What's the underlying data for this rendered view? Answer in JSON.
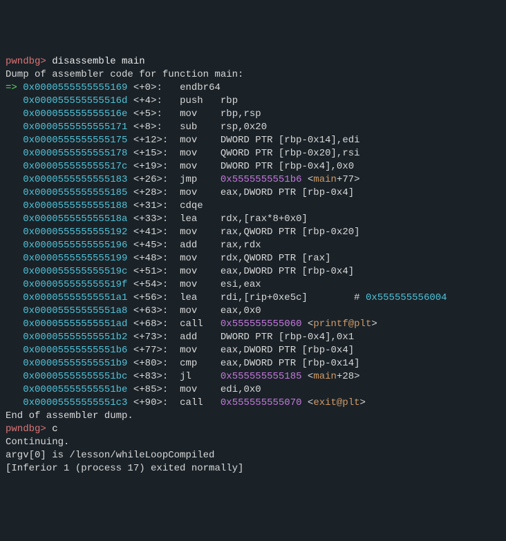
{
  "prompt": "pwndbg>",
  "cmd1": "disassemble main",
  "dump_header": "Dump of assembler code for function main:",
  "arrow": "=>",
  "lines": [
    {
      "addr": "0x0000555555555169",
      "off": "<+0>:",
      "instr": "endbr64"
    },
    {
      "addr": "0x000055555555516d",
      "off": "<+4>:",
      "instr": "push   rbp"
    },
    {
      "addr": "0x000055555555516e",
      "off": "<+5>:",
      "instr": "mov    rbp,rsp"
    },
    {
      "addr": "0x0000555555555171",
      "off": "<+8>:",
      "instr": "sub    rsp,0x20"
    },
    {
      "addr": "0x0000555555555175",
      "off": "<+12>:",
      "instr": "mov    DWORD PTR [rbp-0x14],edi"
    },
    {
      "addr": "0x0000555555555178",
      "off": "<+15>:",
      "instr": "mov    QWORD PTR [rbp-0x20],rsi"
    },
    {
      "addr": "0x000055555555517c",
      "off": "<+19>:",
      "instr": "mov    DWORD PTR [rbp-0x4],0x0"
    },
    {
      "addr": "0x0000555555555183",
      "off": "<+26>:",
      "instr": "jmp    ",
      "ref_addr": "0x5555555551b6",
      "ref_sym": "main",
      "ref_plus": "+77>"
    },
    {
      "addr": "0x0000555555555185",
      "off": "<+28>:",
      "instr": "mov    eax,DWORD PTR [rbp-0x4]"
    },
    {
      "addr": "0x0000555555555188",
      "off": "<+31>:",
      "instr": "cdqe"
    },
    {
      "addr": "0x000055555555518a",
      "off": "<+33>:",
      "instr": "lea    rdx,[rax*8+0x0]"
    },
    {
      "addr": "0x0000555555555192",
      "off": "<+41>:",
      "instr": "mov    rax,QWORD PTR [rbp-0x20]"
    },
    {
      "addr": "0x0000555555555196",
      "off": "<+45>:",
      "instr": "add    rax,rdx"
    },
    {
      "addr": "0x0000555555555199",
      "off": "<+48>:",
      "instr": "mov    rdx,QWORD PTR [rax]"
    },
    {
      "addr": "0x000055555555519c",
      "off": "<+51>:",
      "instr": "mov    eax,DWORD PTR [rbp-0x4]"
    },
    {
      "addr": "0x000055555555519f",
      "off": "<+54>:",
      "instr": "mov    esi,eax"
    },
    {
      "addr": "0x00005555555551a1",
      "off": "<+56>:",
      "instr": "lea    rdi,[rip+0xe5c]        ",
      "comment": "# ",
      "ref_addr": "0x555555556004"
    },
    {
      "addr": "0x00005555555551a8",
      "off": "<+63>:",
      "instr": "mov    eax,0x0"
    },
    {
      "addr": "0x00005555555551ad",
      "off": "<+68>:",
      "instr": "call   ",
      "ref_addr": "0x555555555060",
      "ref_sym": "printf@plt",
      "ref_plus": ">"
    },
    {
      "addr": "0x00005555555551b2",
      "off": "<+73>:",
      "instr": "add    DWORD PTR [rbp-0x4],0x1"
    },
    {
      "addr": "0x00005555555551b6",
      "off": "<+77>:",
      "instr": "mov    eax,DWORD PTR [rbp-0x4]"
    },
    {
      "addr": "0x00005555555551b9",
      "off": "<+80>:",
      "instr": "cmp    eax,DWORD PTR [rbp-0x14]"
    },
    {
      "addr": "0x00005555555551bc",
      "off": "<+83>:",
      "instr": "jl     ",
      "ref_addr": "0x555555555185",
      "ref_sym": "main",
      "ref_plus": "+28>"
    },
    {
      "addr": "0x00005555555551be",
      "off": "<+85>:",
      "instr": "mov    edi,0x0"
    },
    {
      "addr": "0x00005555555551c3",
      "off": "<+90>:",
      "instr": "call   ",
      "ref_addr": "0x555555555070",
      "ref_sym": "exit@plt",
      "ref_plus": ">"
    }
  ],
  "dump_footer": "End of assembler dump.",
  "cmd2": "c",
  "continuing": "Continuing.",
  "argv_line": "argv[0] is /lesson/whileLoopCompiled",
  "inferior": "[Inferior 1 (process 17) exited normally]"
}
